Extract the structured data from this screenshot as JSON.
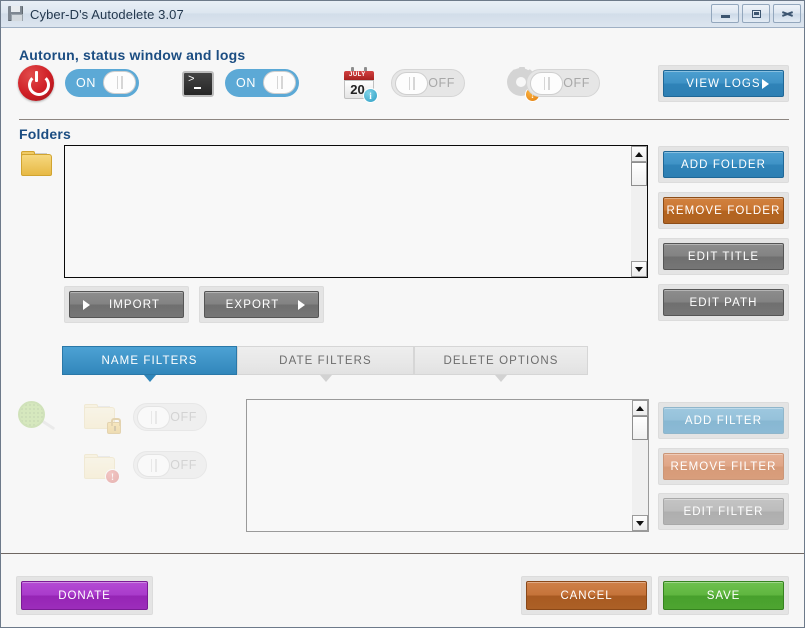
{
  "window": {
    "title": "Cyber-D's Autodelete 3.07",
    "icon": "floppy-disk-icon",
    "controls": {
      "minimize": "minimize-icon",
      "maximize": "maximize-icon",
      "close": "close-icon"
    }
  },
  "autorun_section": {
    "heading": "Autorun, status window and logs",
    "items": [
      {
        "icon": "power-icon",
        "toggle_label": "ON",
        "state": "on"
      },
      {
        "icon": "console-icon",
        "toggle_label": "ON",
        "state": "on"
      },
      {
        "icon": "calendar-icon",
        "toggle_label": "OFF",
        "state": "off",
        "calendar_month": "JULY",
        "calendar_day": "20",
        "badge": "info-badge"
      },
      {
        "icon": "gear-icon",
        "toggle_label": "OFF",
        "state": "off",
        "badge": "warning-badge"
      }
    ],
    "view_logs_button": "VIEW LOGS"
  },
  "folders_section": {
    "heading": "Folders",
    "icon": "folder-icon",
    "list_items": [],
    "import_button": "IMPORT",
    "export_button": "EXPORT",
    "buttons": [
      {
        "label": "ADD FOLDER",
        "style": "blue"
      },
      {
        "label": "REMOVE FOLDER",
        "style": "orange"
      },
      {
        "label": "EDIT TITLE",
        "style": "gray"
      },
      {
        "label": "EDIT PATH",
        "style": "gray"
      }
    ]
  },
  "tabs": [
    {
      "label": "NAME FILTERS",
      "active": true
    },
    {
      "label": "DATE FILTERS",
      "active": false
    },
    {
      "label": "DELETE OPTIONS",
      "active": false
    }
  ],
  "filters_panel": {
    "sieve_icon": "sieve-icon",
    "rows": [
      {
        "icon": "folder-lock-icon",
        "toggle_label": "OFF",
        "state": "off"
      },
      {
        "icon": "folder-exclamation-icon",
        "toggle_label": "OFF",
        "state": "off"
      }
    ],
    "list_items": [],
    "buttons": [
      {
        "label": "ADD FILTER",
        "style": "blue-faded"
      },
      {
        "label": "REMOVE FILTER",
        "style": "orange-faded"
      },
      {
        "label": "EDIT FILTER",
        "style": "gray-faded"
      }
    ]
  },
  "footer": {
    "donate_button": "DONATE",
    "cancel_button": "CANCEL",
    "save_button": "SAVE"
  },
  "colors": {
    "accent_blue": "#3e93c6",
    "orange": "#c5743a",
    "green": "#5fb63f",
    "purple": "#a93bcb",
    "red": "#cf1f26",
    "heading_blue": "#1b4d82",
    "background": "#f7f7f7"
  }
}
